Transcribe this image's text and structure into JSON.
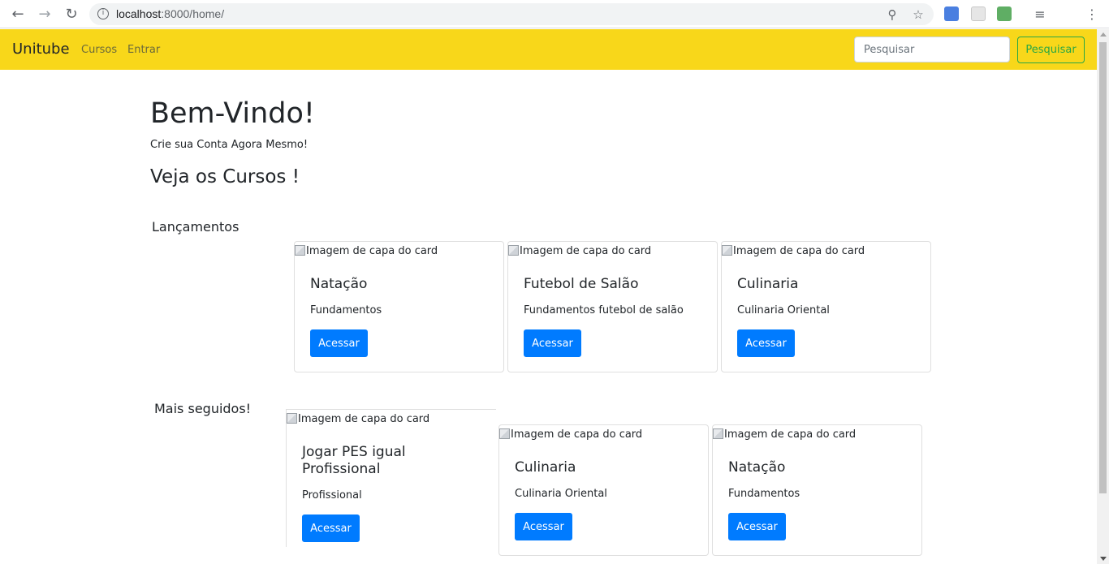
{
  "browser": {
    "url_host": "localhost",
    "url_path": ":8000/home/"
  },
  "navbar": {
    "brand": "Unitube",
    "links": [
      "Cursos",
      "Entrar"
    ],
    "search_placeholder": "Pesquisar",
    "search_button": "Pesquisar",
    "bg_color": "#f8d71a"
  },
  "hero": {
    "title": "Bem-Vindo!",
    "subtitle": "Crie sua Conta Agora Mesmo!",
    "courses_heading": "Veja os Cursos !"
  },
  "sections": [
    {
      "title": "Lançamentos",
      "cards": [
        {
          "img_alt": "Imagem de capa do card",
          "title": "Natação",
          "text": "Fundamentos",
          "button": "Acessar"
        },
        {
          "img_alt": "Imagem de capa do card",
          "title": "Futebol de Salão",
          "text": "Fundamentos futebol de salão",
          "button": "Acessar"
        },
        {
          "img_alt": "Imagem de capa do card",
          "title": "Culinaria",
          "text": "Culinaria Oriental",
          "button": "Acessar"
        }
      ]
    },
    {
      "title": "Mais seguidos!",
      "cards": [
        {
          "img_alt": "Imagem de capa do card",
          "title": "Jogar PES igual Profissional",
          "text": "Profissional",
          "button": "Acessar"
        },
        {
          "img_alt": "Imagem de capa do card",
          "title": "Culinaria",
          "text": "Culinaria Oriental",
          "button": "Acessar"
        },
        {
          "img_alt": "Imagem de capa do card",
          "title": "Natação",
          "text": "Fundamentos",
          "button": "Acessar"
        }
      ]
    }
  ]
}
